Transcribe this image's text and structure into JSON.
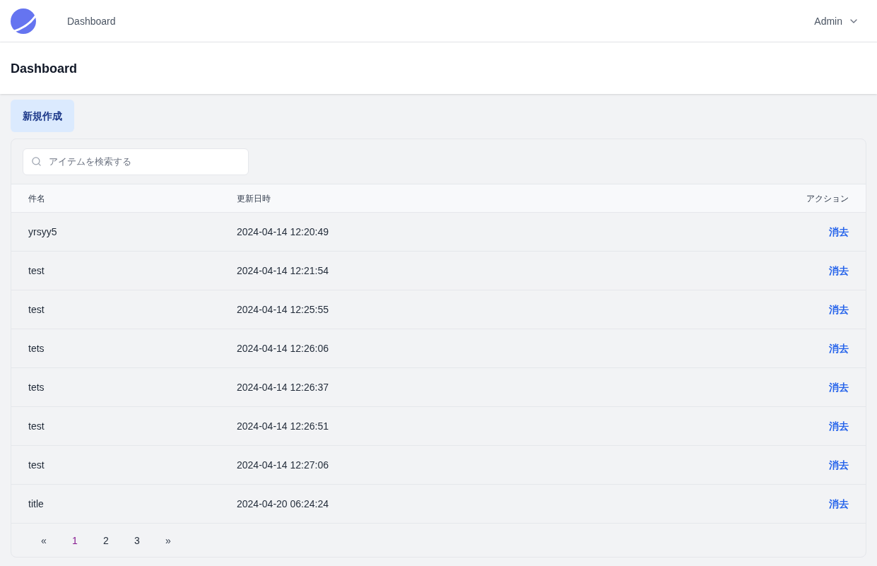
{
  "nav": {
    "link": "Dashboard",
    "user": "Admin"
  },
  "page_title": "Dashboard",
  "create_button": "新規作成",
  "search": {
    "placeholder": "アイテムを検索する"
  },
  "table": {
    "columns": [
      "件名",
      "更新日時",
      "アクション"
    ],
    "rows": [
      {
        "title": "yrsyy5",
        "updated": "2024-04-14 12:20:49",
        "action": "消去"
      },
      {
        "title": "test",
        "updated": "2024-04-14 12:21:54",
        "action": "消去"
      },
      {
        "title": "test",
        "updated": "2024-04-14 12:25:55",
        "action": "消去"
      },
      {
        "title": "tets",
        "updated": "2024-04-14 12:26:06",
        "action": "消去"
      },
      {
        "title": "tets",
        "updated": "2024-04-14 12:26:37",
        "action": "消去"
      },
      {
        "title": "test",
        "updated": "2024-04-14 12:26:51",
        "action": "消去"
      },
      {
        "title": "test",
        "updated": "2024-04-14 12:27:06",
        "action": "消去"
      },
      {
        "title": "title",
        "updated": "2024-04-20 06:24:24",
        "action": "消去"
      }
    ]
  },
  "pagination": [
    {
      "label": "«",
      "kind": "prev"
    },
    {
      "label": "1",
      "kind": "page",
      "selected": true
    },
    {
      "label": "2",
      "kind": "page",
      "selected": false
    },
    {
      "label": "3",
      "kind": "page",
      "selected": false
    },
    {
      "label": "»",
      "kind": "next"
    }
  ]
}
